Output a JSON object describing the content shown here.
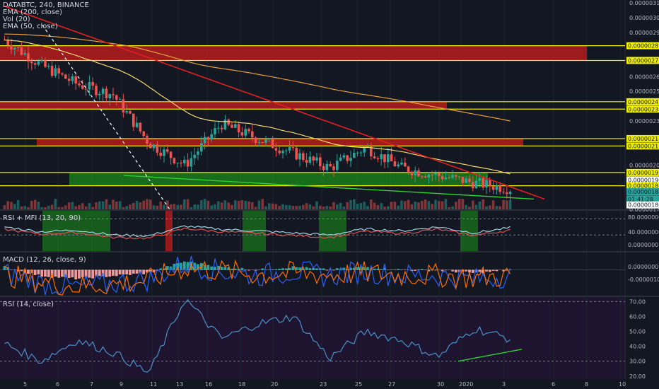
{
  "symbol_header": "DATABTC, 240, BINANCE",
  "legend_lines": [
    "EMA (200, close)",
    "Vol (20)",
    "EMA (50, close)"
  ],
  "price_axis": {
    "ticks": [
      "0.00000310",
      "0.00000300",
      "0.00000290",
      "0.00000260",
      "0.00000250",
      "0.00000230",
      "0.00000200",
      "0.00000180",
      "0.00000170",
      "0.00000160"
    ],
    "tags": [
      {
        "label": "0.00000281",
        "price": 281,
        "color": "#f0f000"
      },
      {
        "label": "0.00000271",
        "price": 271,
        "color": "#f0f000"
      },
      {
        "label": "0.00000243",
        "price": 243,
        "color": "#f0f000"
      },
      {
        "label": "0.00000238",
        "price": 238,
        "color": "#f0f000"
      },
      {
        "label": "0.00000218",
        "price": 218,
        "color": "#f0f000"
      },
      {
        "label": "0.00000213",
        "price": 213,
        "color": "#f0f000"
      },
      {
        "label": "0.00000195",
        "price": 195,
        "color": "#f0f000"
      },
      {
        "label": "0.00000190",
        "price": 190,
        "color": "#ffffff"
      },
      {
        "label": "0.00000186",
        "price": 186,
        "color": "#f0f000"
      },
      {
        "label": "0.00000184",
        "price": 182,
        "color": "#26a69a"
      },
      {
        "label": "01:41:28",
        "price": 177,
        "color": "#26a69a"
      },
      {
        "label": "0.00000180",
        "price": 173,
        "color": "#ffffff"
      }
    ]
  },
  "time_axis": [
    "5",
    "6",
    "7",
    "9",
    "11",
    "13",
    "16",
    "18",
    "20",
    "23",
    "25",
    "27",
    "30",
    "2020",
    "3",
    "6",
    "8",
    "10"
  ],
  "rsi_mfi": {
    "label": "RSI + MFI (13, 20, 90)",
    "ticks": [
      "80.0000000",
      "40.0000000",
      "0.0000000"
    ]
  },
  "macd": {
    "label": "MACD (12, 26, close, 9)",
    "ticks": [
      "0.0000000",
      "-0.0000010"
    ]
  },
  "rsi": {
    "label": "RSI (14, close)",
    "ticks": [
      "70.00",
      "60.00",
      "50.00",
      "40.00",
      "30.00",
      "20.00"
    ]
  },
  "colors": {
    "up": "#26a69a",
    "down": "#ef5350",
    "zone_red": "#b71c1c",
    "zone_green": "#1b8a1b",
    "line_yellow": "#f0f000",
    "ema": "#f7d774",
    "rsi_line": "#4a90c8"
  },
  "chart_data": [
    {
      "type": "candlestick",
      "title": "DATABTC, 240, BINANCE",
      "x": [
        "5",
        "6",
        "7",
        "9",
        "11",
        "13",
        "16",
        "18",
        "20",
        "23",
        "25",
        "27",
        "30",
        "2020",
        "3"
      ],
      "close": [
        285,
        268,
        255,
        248,
        215,
        200,
        228,
        218,
        208,
        198,
        212,
        198,
        193,
        188,
        184
      ],
      "ylim": [
        170,
        312
      ],
      "horizontal_levels": [
        281,
        271,
        243,
        238,
        218,
        213,
        195,
        186
      ],
      "zones": [
        {
          "color": "red",
          "from": 271,
          "to": 281
        },
        {
          "color": "red",
          "from": 238,
          "to": 243
        },
        {
          "color": "red",
          "from": 213,
          "to": 218
        },
        {
          "color": "green",
          "from": 186,
          "to": 195
        }
      ]
    },
    {
      "type": "line",
      "title": "RSI + MFI (13, 20, 90)",
      "series": [
        {
          "values": [
            60,
            48,
            52,
            40,
            38,
            62,
            54,
            50,
            45,
            40,
            55,
            50,
            60,
            45,
            58
          ]
        }
      ],
      "ylim": [
        0,
        100
      ]
    },
    {
      "type": "bar",
      "title": "MACD (12, 26, close, 9)",
      "series": [
        {
          "values": [
            1,
            -2,
            -3,
            -2,
            -1,
            3,
            1,
            0,
            1,
            0,
            1,
            0,
            0,
            -1,
            0
          ]
        }
      ]
    },
    {
      "type": "line",
      "title": "RSI (14, close)",
      "series": [
        {
          "values": [
            42,
            30,
            44,
            36,
            22,
            72,
            45,
            55,
            60,
            32,
            50,
            44,
            33,
            52,
            45
          ]
        }
      ],
      "ylim": [
        18,
        73
      ]
    }
  ]
}
